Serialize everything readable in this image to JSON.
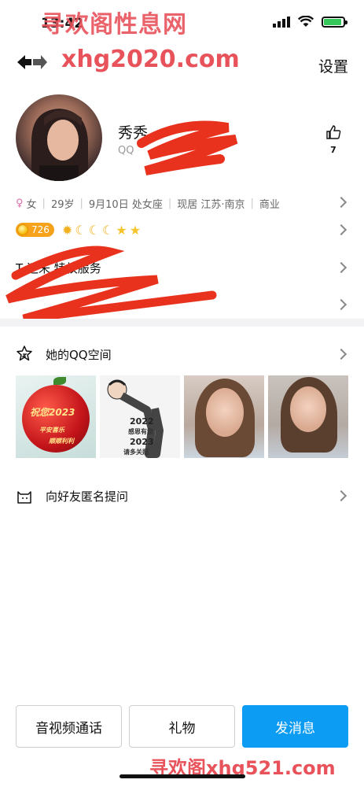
{
  "status_bar": {
    "time": "13:42"
  },
  "watermarks": {
    "top": "寻欢阁性息网",
    "url": "xhg2020.com",
    "bottom": "寻欢阁xhg521.com"
  },
  "nav": {
    "settings": "设置"
  },
  "profile": {
    "name": "秀秀",
    "qq_prefix": "QQ",
    "likes": "7"
  },
  "info": {
    "gender": "女",
    "age": "29岁",
    "birthday": "9月10日 处女座",
    "location": "现居 江苏·南京",
    "industry": "商业"
  },
  "level": {
    "coin_value": "726"
  },
  "rows": {
    "privilege": "T 还未  特权服务"
  },
  "qzone": {
    "label": "她的QQ空间"
  },
  "photos": {
    "p1": {
      "main": "祝您2023",
      "sub1": "平安喜乐",
      "sub2": "顺顺利利"
    },
    "p2": {
      "year1": "2022",
      "mid": "感恩有您",
      "year2": "2023",
      "bottom": "请多关照"
    }
  },
  "ask": {
    "label": "向好友匿名提问"
  },
  "buttons": {
    "call": "音视频通话",
    "gift": "礼物",
    "message": "发消息"
  },
  "colors": {
    "primary": "#0d9cf3",
    "watermark": "#e8535b",
    "coin": "#f6a21a"
  }
}
